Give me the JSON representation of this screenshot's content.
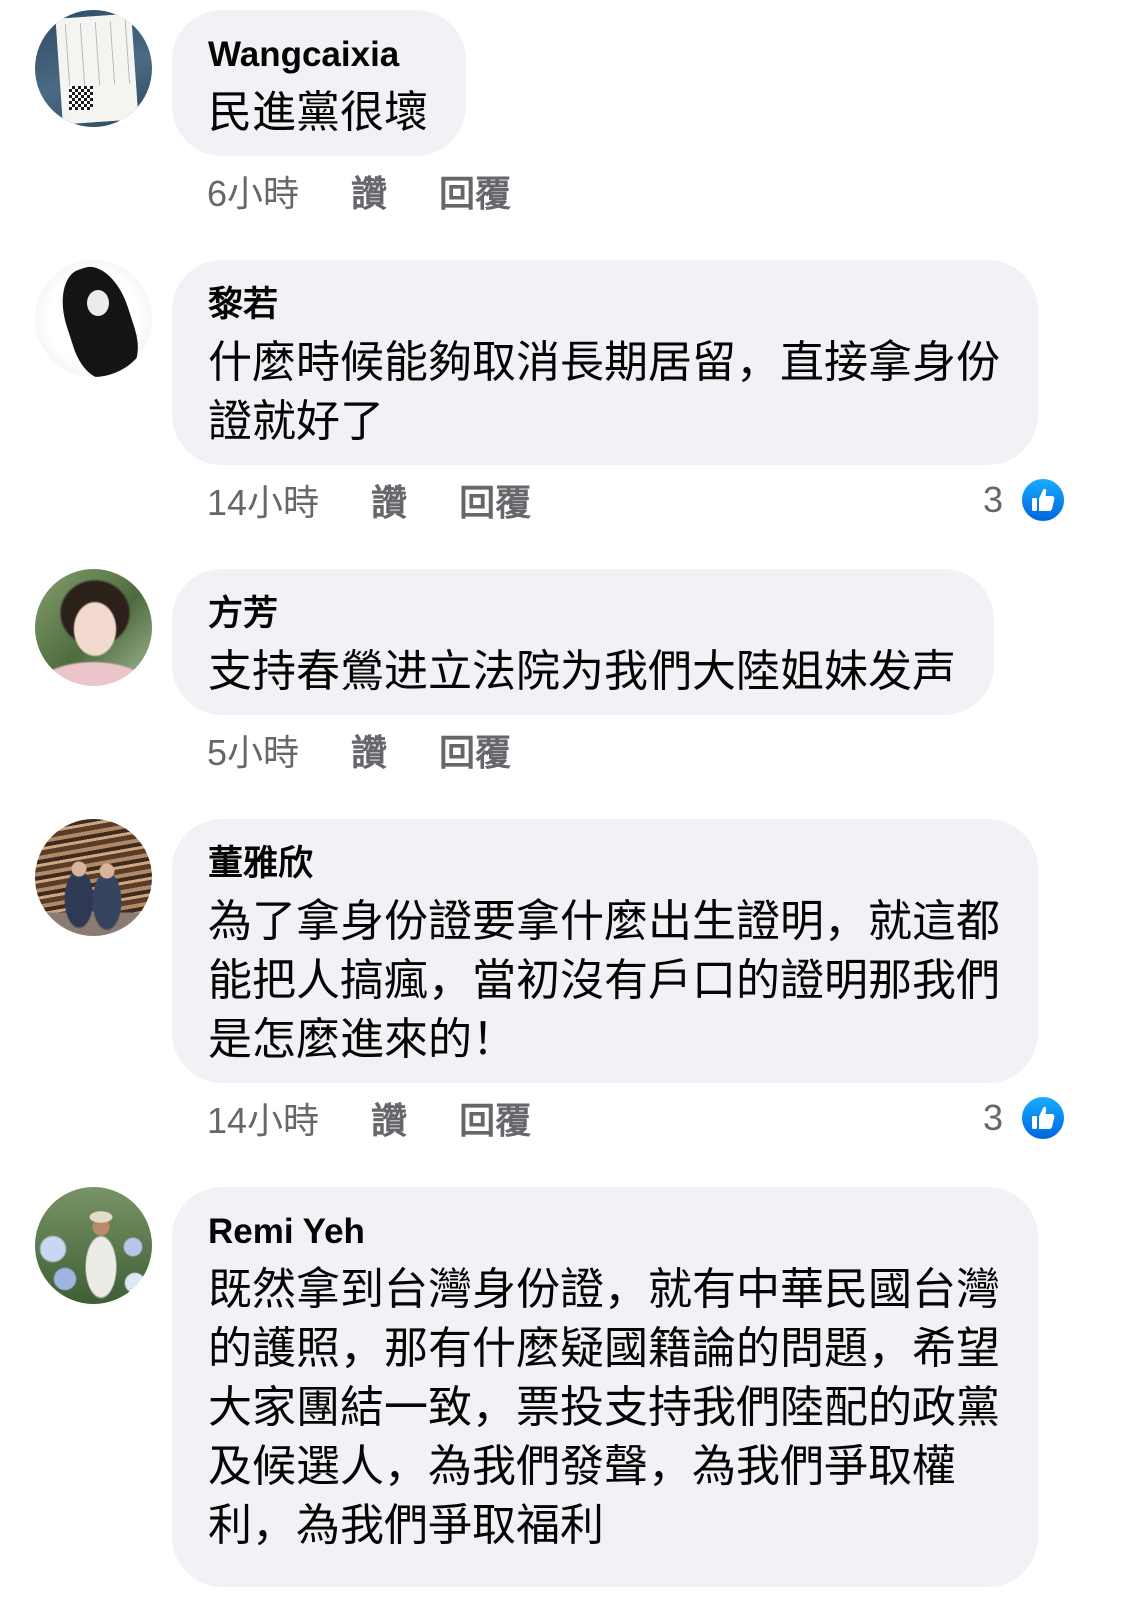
{
  "comments": [
    {
      "author": "Wangcaixia",
      "text_lines": [
        "民進黨很壞"
      ],
      "time": "6小時",
      "like_label": "讚",
      "reply_label": "回覆"
    },
    {
      "author": "黎若",
      "text_lines": [
        "什麼時候能夠取消長期居留，直接拿身份",
        "證就好了"
      ],
      "time": "14小時",
      "like_label": "讚",
      "reply_label": "回覆",
      "reactions": {
        "count": "3",
        "icon": "like-icon"
      }
    },
    {
      "author": "方芳",
      "text_lines": [
        "支持春鶯进立法院为我們大陸姐妹发声"
      ],
      "time": "5小時",
      "like_label": "讚",
      "reply_label": "回覆"
    },
    {
      "author": "董雅欣",
      "text_lines": [
        "為了拿身份證要拿什麼出生證明，就這都",
        "能把人搞瘋，當初沒有戶口的證明那我們",
        "是怎麼進來的！"
      ],
      "time": "14小時",
      "like_label": "讚",
      "reply_label": "回覆",
      "reactions": {
        "count": "3",
        "icon": "like-icon"
      }
    },
    {
      "author": "Remi Yeh",
      "text_lines": [
        "既然拿到台灣身份證，就有中華民國台灣",
        "的護照，那有什麼疑國籍論的問題，希望",
        "大家團結一致，票投支持我們陸配的政黨",
        "及候選人，為我們發聲，為我們爭取權",
        "利，為我們爭取福利"
      ]
    }
  ],
  "colors": {
    "bubble_bg": "#f0f2f5",
    "primary_text": "#050505",
    "secondary_text": "#65676b",
    "like_blue": "#1877f2"
  }
}
